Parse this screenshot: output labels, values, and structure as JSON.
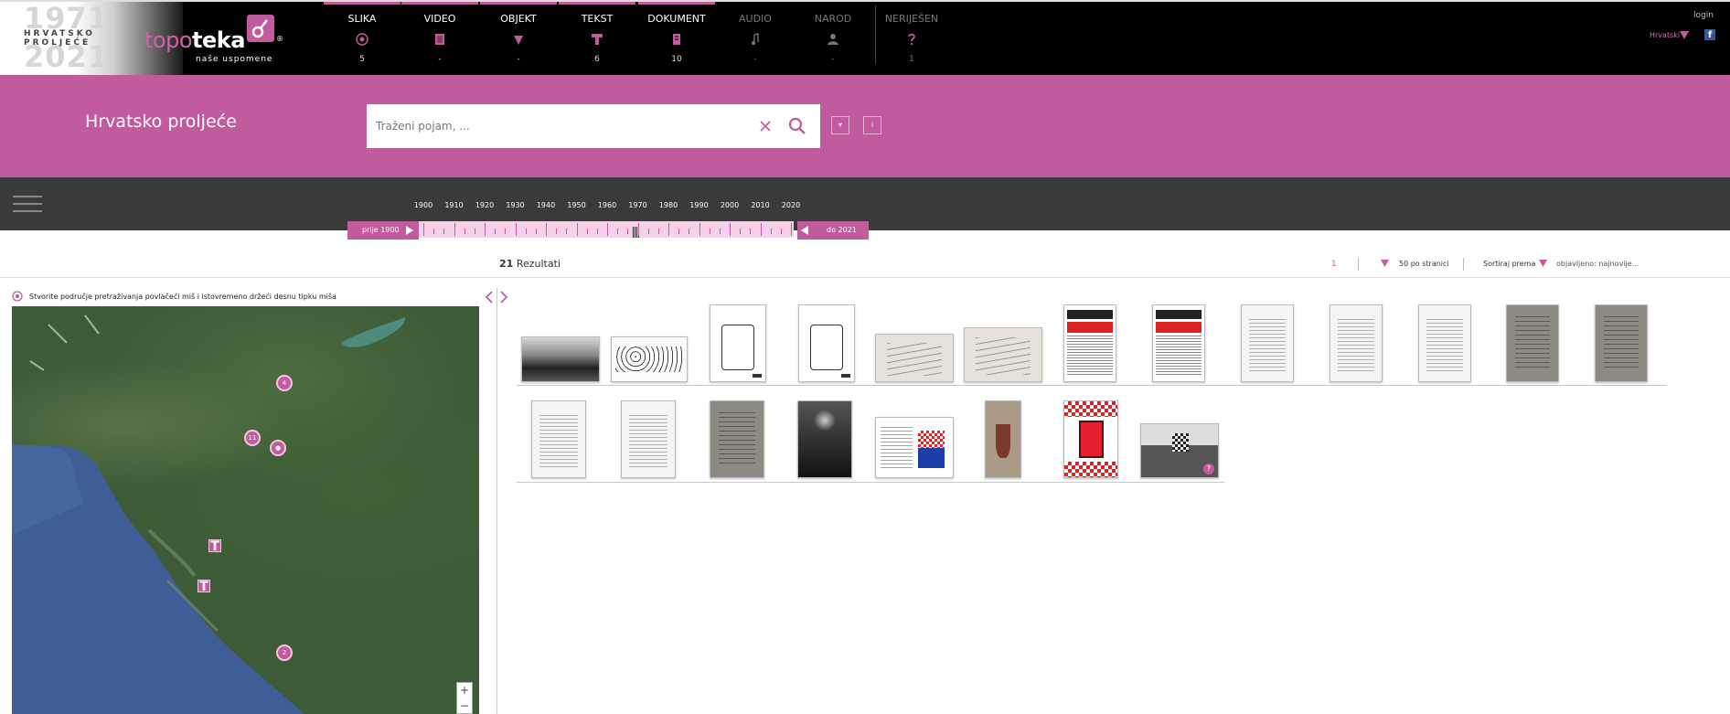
{
  "colors": {
    "accent": "#c25a9e",
    "topbar": "#000000",
    "timeline": "#3a3a3a"
  },
  "logo": {
    "year_top": "1971",
    "year_bottom": "2021",
    "line1": "HRVATSKO",
    "line2": "PROLJEĆE",
    "brand_a": "topo",
    "brand_b": "teka",
    "reg": "®",
    "subtitle": "naše uspomene"
  },
  "nav": [
    {
      "label": "SLIKA",
      "count": "5",
      "icon": "image-icon",
      "active": true
    },
    {
      "label": "VIDEO",
      "count": "-",
      "icon": "video-icon",
      "active": true
    },
    {
      "label": "OBJEKT",
      "count": "-",
      "icon": "object-icon",
      "active": true
    },
    {
      "label": "TEKST",
      "count": "6",
      "icon": "text-icon",
      "active": true
    },
    {
      "label": "DOKUMENT",
      "count": "10",
      "icon": "document-icon",
      "active": true
    },
    {
      "label": "AUDIO",
      "count": "-",
      "icon": "audio-icon",
      "active": false
    },
    {
      "label": "NAROD",
      "count": "-",
      "icon": "people-icon",
      "active": false
    },
    {
      "label": "NERIJEŠEN",
      "count": "1",
      "icon": "question-icon",
      "active": false
    }
  ],
  "header_right": {
    "login": "login",
    "language": "Hrvatski",
    "facebook": "f"
  },
  "band": {
    "title": "Hrvatsko proljeće",
    "search_placeholder": "Traženi pojam, ...",
    "options_button": "▾",
    "info_button": "i"
  },
  "timeline": {
    "years": [
      "1900",
      "1910",
      "1920",
      "1930",
      "1940",
      "1950",
      "1960",
      "1970",
      "1980",
      "1990",
      "2000",
      "2010",
      "2020"
    ],
    "from_label": "prije 1900",
    "to_label": "do 2021"
  },
  "results": {
    "count": "21",
    "label": "Rezultati",
    "page": "1",
    "per_page": "50 po stranici",
    "sort_label": "Sortiraj prema",
    "sort_value": "objavljeno: najnovije..."
  },
  "map": {
    "hint": "Stvorite područje pretraživanja povlačeći miš i istovremeno držeći desnu tipku miša",
    "pins": [
      "4",
      "11",
      "2"
    ],
    "text_pin": "T",
    "zoom_in": "+",
    "zoom_out": "−"
  },
  "thumbnails": [
    {
      "type": "photo"
    },
    {
      "type": "crowdcartoon"
    },
    {
      "type": "cartoon"
    },
    {
      "type": "cartoon"
    },
    {
      "type": "letter"
    },
    {
      "type": "letter"
    },
    {
      "type": "news"
    },
    {
      "type": "news"
    },
    {
      "type": "doc"
    },
    {
      "type": "doc"
    },
    {
      "type": "doc"
    },
    {
      "type": "grey"
    },
    {
      "type": "grey"
    },
    {
      "type": "doc"
    },
    {
      "type": "doc"
    },
    {
      "type": "grey"
    },
    {
      "type": "portrait"
    },
    {
      "type": "hdz"
    },
    {
      "type": "coat"
    },
    {
      "type": "red"
    },
    {
      "type": "crowd"
    }
  ]
}
